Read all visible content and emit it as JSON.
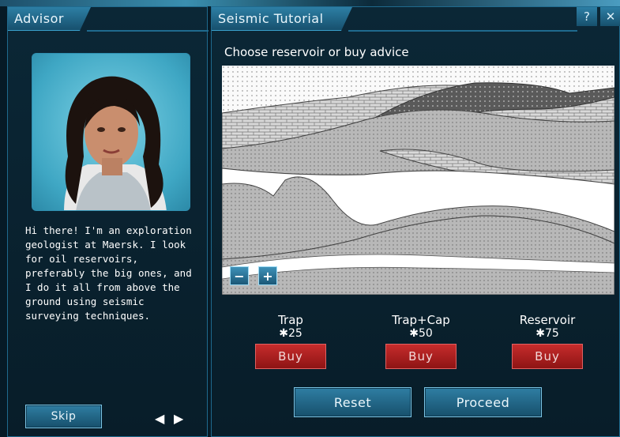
{
  "advisor": {
    "title": "Advisor",
    "text": "Hi there! I'm an exploration geologist at Maersk. I look for oil reservoirs, preferably the big ones, and I do it all from above the ground using seismic surveying techniques.",
    "skip_label": "Skip",
    "prev_icon": "◀",
    "next_icon": "▶"
  },
  "tutorial": {
    "title": "Seismic Tutorial",
    "help_label": "?",
    "close_label": "✕",
    "subtitle": "Choose reservoir or buy advice",
    "zoom_out_label": "−",
    "zoom_in_label": "+",
    "options": [
      {
        "label": "Trap",
        "cost": "✱25",
        "buy_label": "Buy"
      },
      {
        "label": "Trap+Cap",
        "cost": "✱50",
        "buy_label": "Buy"
      },
      {
        "label": "Reservoir",
        "cost": "✱75",
        "buy_label": "Buy"
      }
    ],
    "reset_label": "Reset",
    "proceed_label": "Proceed"
  },
  "colors": {
    "accent": "#1f6a8e",
    "buy": "#b02020",
    "button": "#1f6a8e"
  }
}
